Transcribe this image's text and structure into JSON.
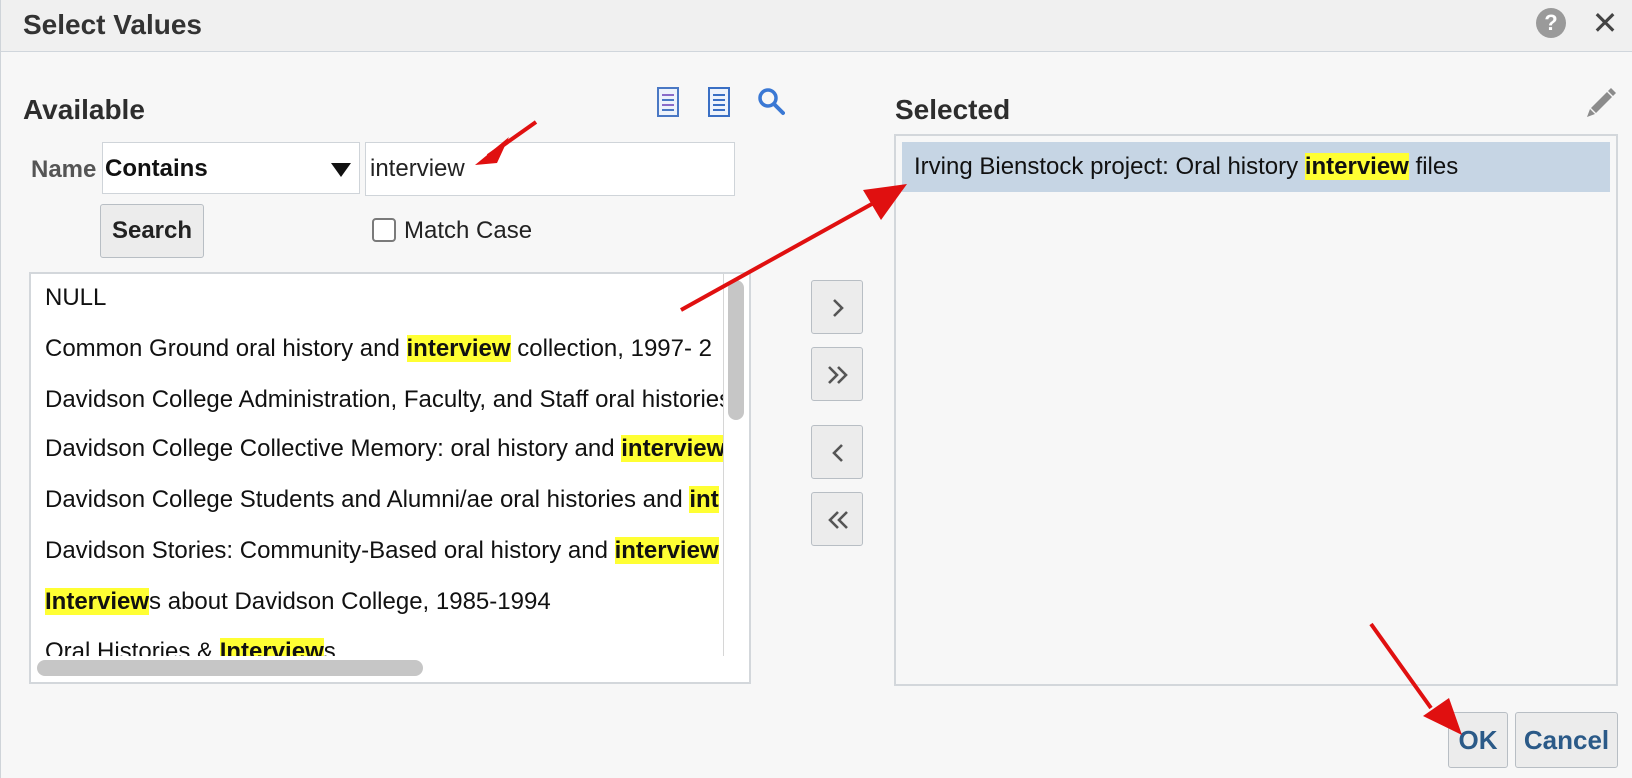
{
  "dialog": {
    "title": "Select Values",
    "help_icon": "?",
    "close_icon": "✕"
  },
  "available": {
    "heading": "Available",
    "toolbar_icons": [
      "list-icon",
      "list-icon",
      "search-icon"
    ],
    "filter": {
      "field_label": "Name",
      "operator": "Contains",
      "value": "interview"
    },
    "search_label": "Search",
    "match_case_label": "Match Case",
    "match_case_checked": false,
    "items": [
      [
        "NULL"
      ],
      [
        "Common Ground oral history and ",
        "interview",
        " collection, 1997- 2"
      ],
      [
        "Davidson College Administration, Faculty, and Staff oral histories"
      ],
      [
        "Davidson College Collective Memory: oral history and ",
        "interview"
      ],
      [
        "Davidson College Students and Alumni/ae oral histories and ",
        "int"
      ],
      [
        "Davidson Stories: Community-Based oral history and ",
        "interview"
      ],
      [
        "",
        "Interview",
        "s about Davidson College, 1985-1994"
      ],
      [
        "Oral Histories & ",
        "Interview",
        "s"
      ]
    ]
  },
  "shuttle": {
    "move": "move-right-icon",
    "move_all": "move-all-right-icon",
    "remove": "move-left-icon",
    "remove_all": "move-all-left-icon"
  },
  "selected": {
    "heading": "Selected",
    "items": [
      [
        "Irving Bienstock project: Oral history ",
        "interview",
        " files"
      ]
    ]
  },
  "buttons": {
    "ok": "OK",
    "cancel": "Cancel"
  },
  "colors": {
    "highlight": "#ffff33",
    "selected_row": "#c6d5e4",
    "annotation_arrow": "#e01010",
    "button_text": "#2b5a88"
  }
}
